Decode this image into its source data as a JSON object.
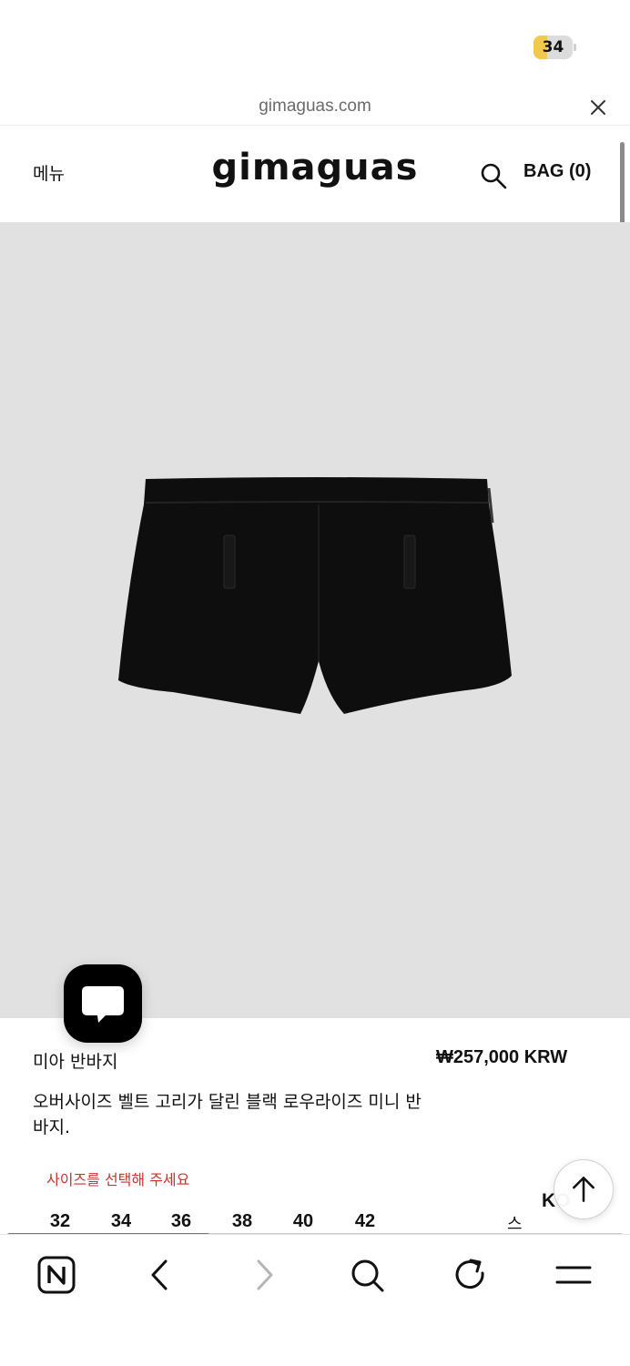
{
  "status_bar": {
    "battery_label": "34",
    "battery_level_percent": 34,
    "battery_color": "#f2c94c"
  },
  "browser": {
    "url": "gimaguas.com",
    "close_icon": "close-icon",
    "toolbar_icons": [
      "naver-home-icon",
      "back-arrow-icon",
      "forward-arrow-icon",
      "search-icon",
      "reload-icon",
      "menu-icon"
    ]
  },
  "header": {
    "menu_label": "메뉴",
    "logo": "gimaguas",
    "search_icon": "search-icon",
    "bag_label": "BAG (0)"
  },
  "gallery": {
    "image_background": "#e1e1e1",
    "image_subject": "black mini shorts",
    "progress_fraction": 0.33
  },
  "product": {
    "name": "미아 반바지",
    "price": "₩257,000 KRW",
    "description": "오버사이즈 벨트 고리가 달린 블랙 로우라이즈 미니 반바지.",
    "size_warning": "사이즈를 선택해 주세요",
    "warning_color": "#d0302a",
    "sizes": [
      "32",
      "34",
      "36",
      "38",
      "40",
      "42"
    ],
    "size_guide_partial": "스",
    "language_label": "KO"
  },
  "floating": {
    "chat_icon": "chat-bubble-icon",
    "scroll_top_icon": "arrow-up-icon"
  }
}
